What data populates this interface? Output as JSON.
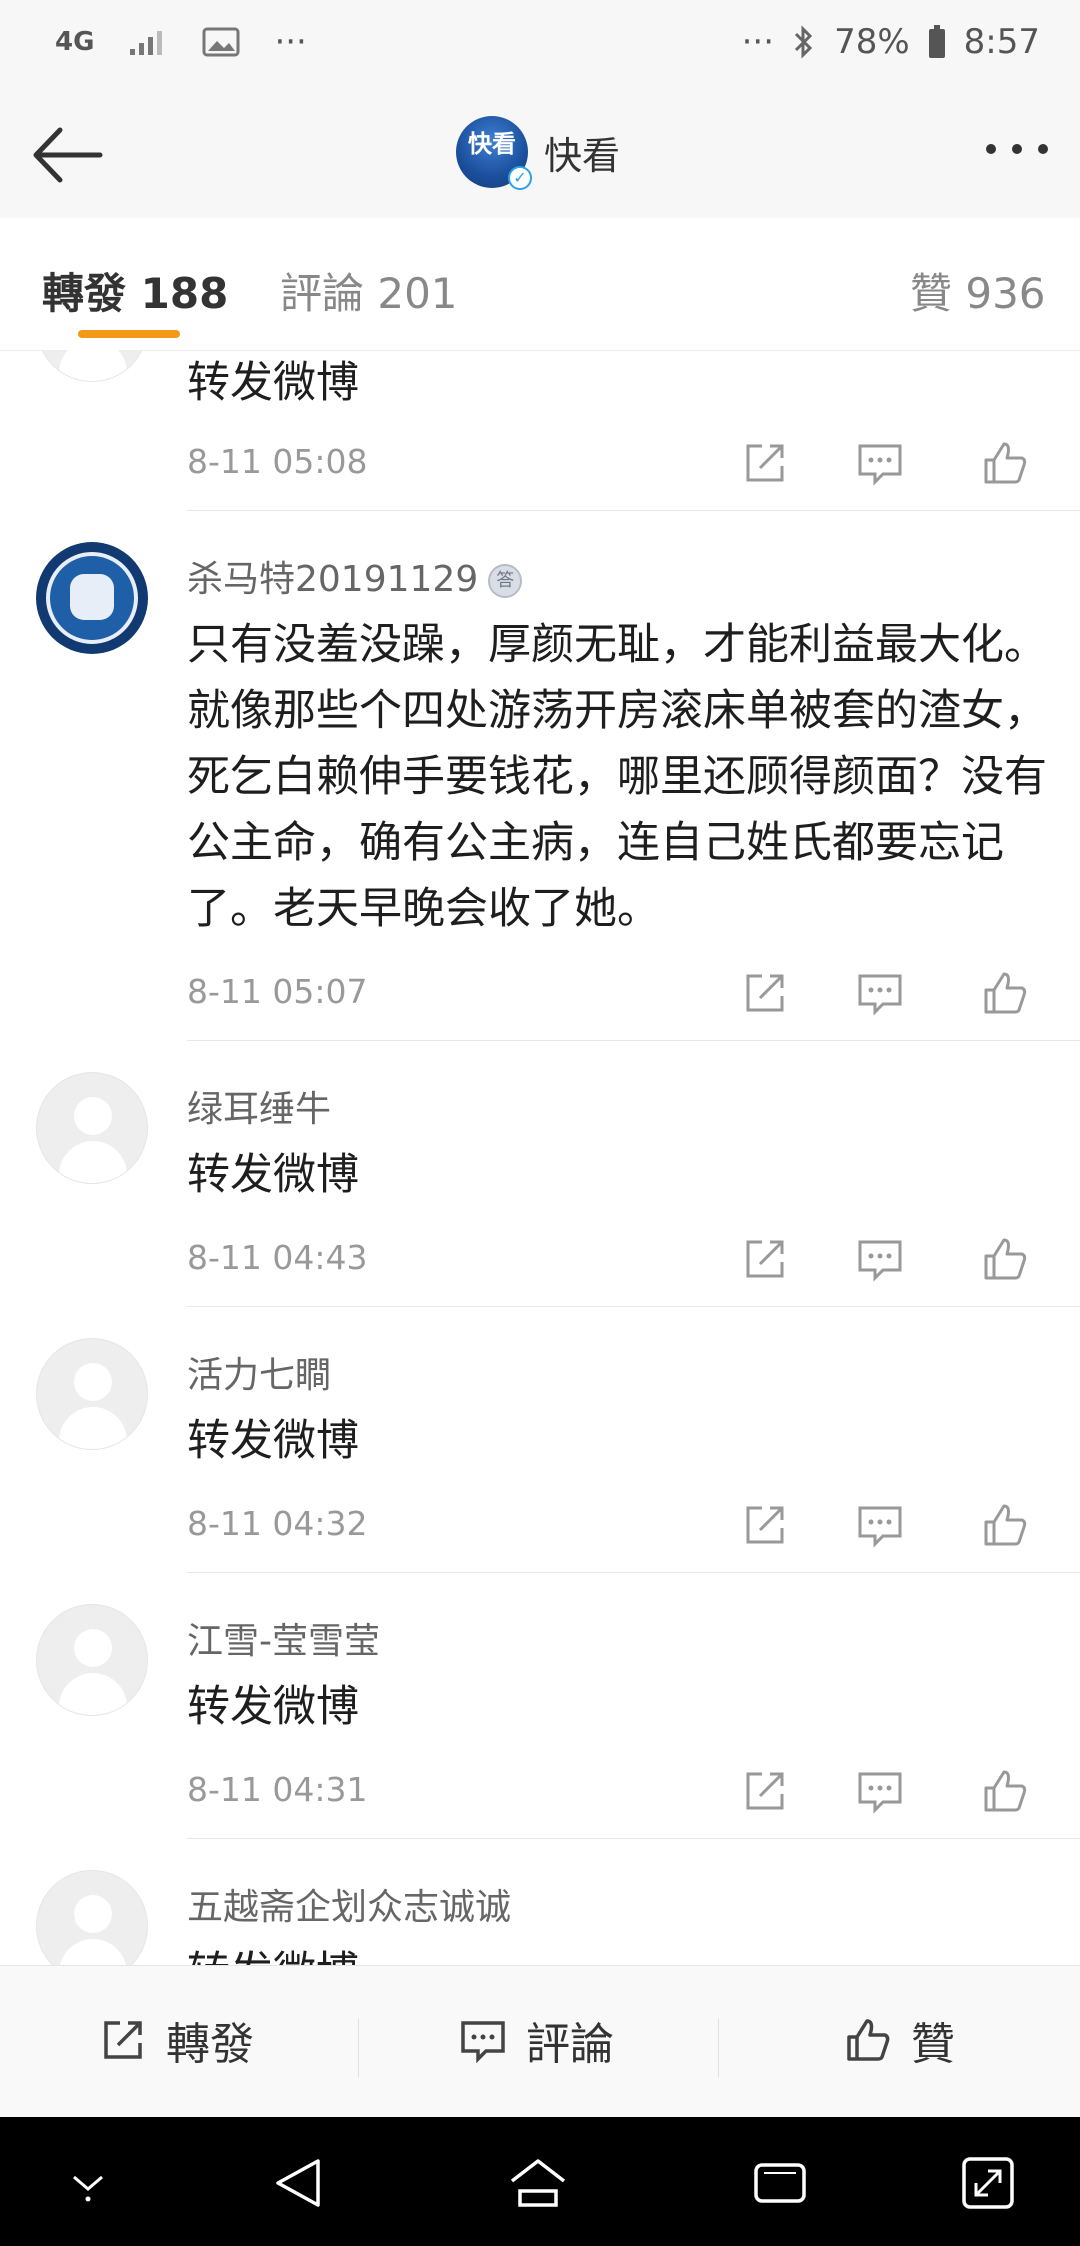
{
  "status_bar": {
    "network": "4G",
    "overflow_left": "···",
    "overflow_right": "···",
    "battery": "78%",
    "time": "8:57"
  },
  "header": {
    "logo_text": "快看",
    "title": "快看"
  },
  "tabs": [
    {
      "label": "轉發 188",
      "active": true
    },
    {
      "label": "評論 201",
      "active": false
    },
    {
      "label": "贊 936",
      "active": false
    }
  ],
  "items": [
    {
      "name": "",
      "content": "转发微博",
      "time": "8-11 05:08"
    },
    {
      "name": "杀马特20191129",
      "medal": "答",
      "content": "只有没羞没躁，厚颜无耻，才能利益最大化。就像那些个四处游荡开房滚床单被套的渣女，死乞白赖伸手要钱花，哪里还顾得颜面？没有公主命，确有公主病，连自己姓氏都要忘记了。老天早晚会收了她。",
      "time": "8-11 05:07"
    },
    {
      "name": "绿耳缍牛",
      "content": "转发微博",
      "time": "8-11 04:43"
    },
    {
      "name": "活力七瞷",
      "content": "转发微博",
      "time": "8-11 04:32"
    },
    {
      "name": "江雪-莹雪莹",
      "content": "转发微博",
      "time": "8-11 04:31"
    },
    {
      "name": "五越斋企划众志诚诚",
      "content": "转发微博",
      "time": ""
    }
  ],
  "bottom_bar": {
    "repost": "轉發",
    "comment": "評論",
    "like": "贊"
  },
  "colors": {
    "accent": "#f29a17",
    "verified": "#2aa3e6"
  }
}
